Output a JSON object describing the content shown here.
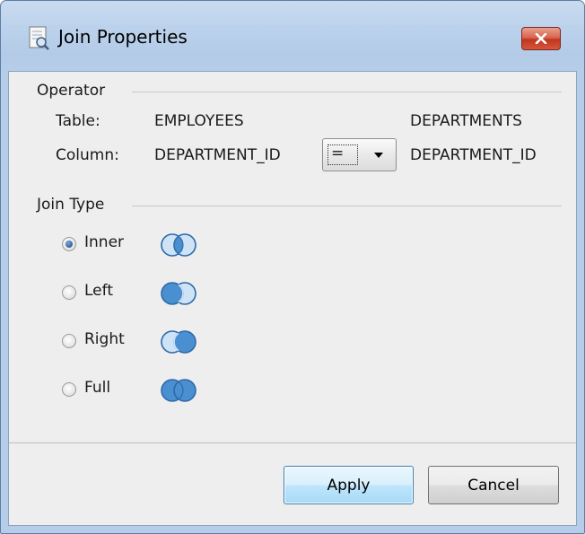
{
  "window": {
    "title": "Join Properties",
    "close_label": "✕"
  },
  "operator": {
    "section_label": "Operator",
    "table_label": "Table:",
    "column_label": "Column:",
    "left_table": "EMPLOYEES",
    "right_table": "DEPARTMENTS",
    "left_column": "DEPARTMENT_ID",
    "right_column": "DEPARTMENT_ID",
    "operator_value": "="
  },
  "join_type": {
    "section_label": "Join Type",
    "options": [
      {
        "label": "Inner",
        "selected": true,
        "icon": "venn-inner-icon"
      },
      {
        "label": "Left",
        "selected": false,
        "icon": "venn-left-icon"
      },
      {
        "label": "Right",
        "selected": false,
        "icon": "venn-right-icon"
      },
      {
        "label": "Full",
        "selected": false,
        "icon": "venn-full-icon"
      }
    ]
  },
  "buttons": {
    "apply": "Apply",
    "cancel": "Cancel"
  },
  "colors": {
    "venn_fill": "#4a8fd0",
    "venn_light": "#cfe3f6",
    "venn_stroke": "#2e6aa8"
  }
}
